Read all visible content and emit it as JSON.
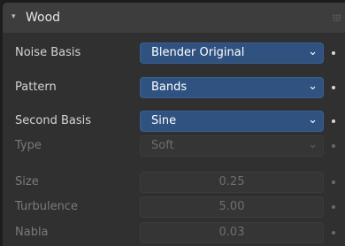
{
  "panel": {
    "title": "Wood",
    "collapse_icon": "triangle-down",
    "grip_icon": "drag-grip"
  },
  "fields": {
    "noise_basis": {
      "label": "Noise Basis",
      "value": "Blender Original"
    },
    "pattern": {
      "label": "Pattern",
      "value": "Bands"
    },
    "second_basis": {
      "label": "Second Basis",
      "value": "Sine"
    },
    "type": {
      "label": "Type",
      "value": "Soft"
    },
    "size": {
      "label": "Size",
      "value": "0.25"
    },
    "turbulence": {
      "label": "Turbulence",
      "value": "5.00"
    },
    "nabla": {
      "label": "Nabla",
      "value": "0.03"
    }
  },
  "glyphs": {
    "collapse": "▾",
    "chevron": "⌄"
  },
  "colors": {
    "active_dropdown": "#2f5281",
    "panel_bg": "#303030",
    "header_bg": "#3d3d3d"
  }
}
